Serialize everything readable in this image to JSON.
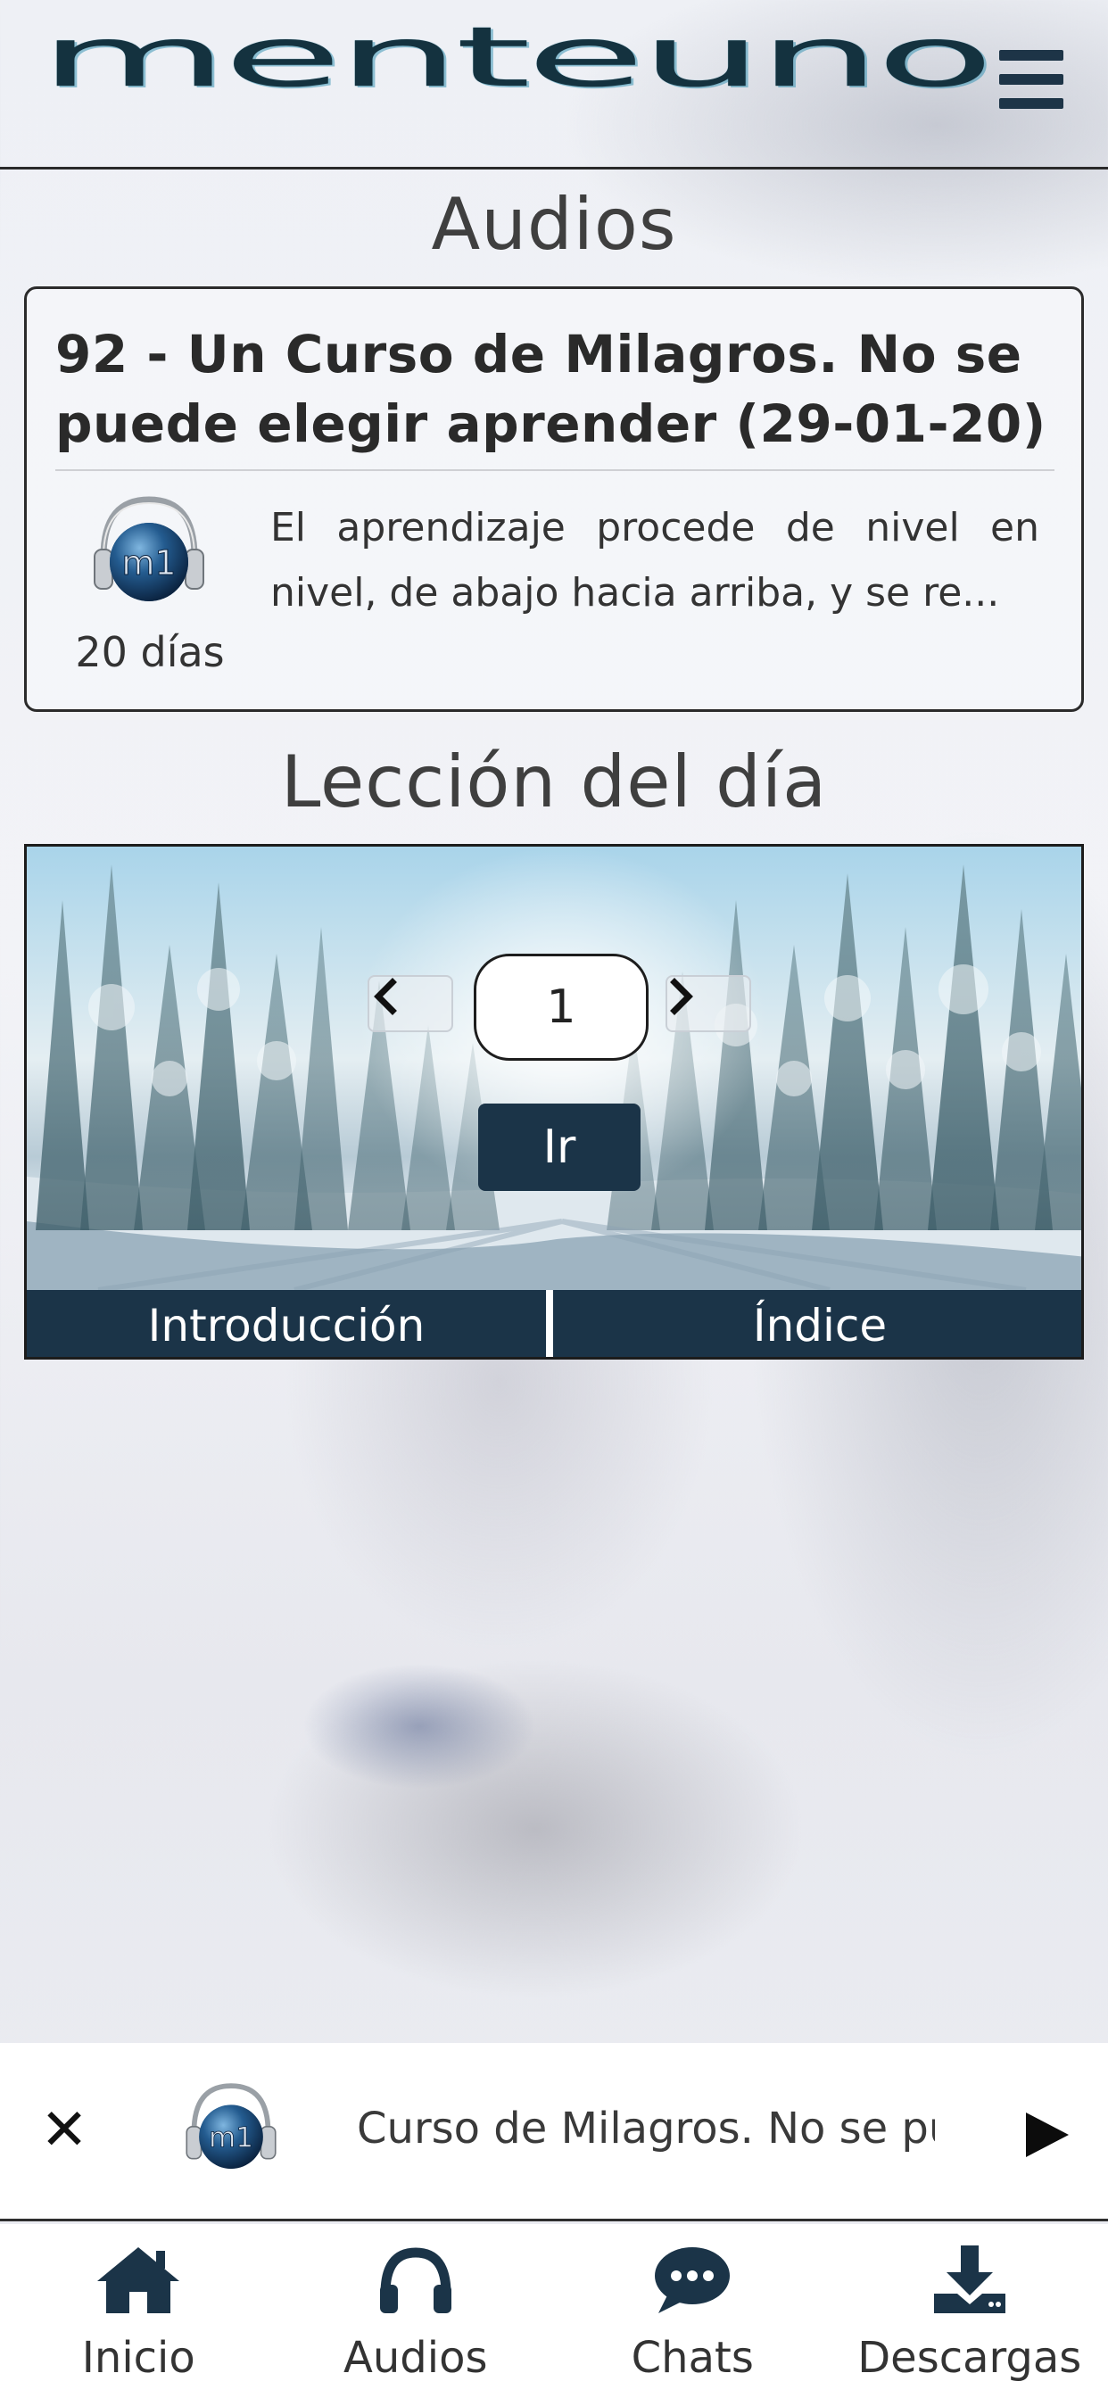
{
  "header": {
    "logo_text": "menteuno",
    "menu_icon": "hamburger-menu-icon",
    "brand_color": "#1b3448"
  },
  "audios_section": {
    "title": "Audios",
    "card": {
      "title": "92 - Un Curso de Milagros. No se puede elegir aprender (29-01-20)",
      "description": "El aprendizaje procede de nivel en nivel, de abajo hacia arriba, y se re...",
      "age": "20 días",
      "avatar_text": "m1"
    }
  },
  "lesson_section": {
    "title": "Lección del día",
    "lesson_number": "1",
    "go_label": "Ir",
    "tabs": [
      {
        "label": "Introducción"
      },
      {
        "label": "Índice"
      }
    ]
  },
  "player": {
    "now_playing": "Curso de Milagros. No se puede elegir aprender",
    "avatar_text": "m1"
  },
  "bottom_nav": {
    "items": [
      {
        "label": "Inicio",
        "icon": "home-icon"
      },
      {
        "label": "Audios",
        "icon": "headphones-icon"
      },
      {
        "label": "Chats",
        "icon": "chat-bubble-icon"
      },
      {
        "label": "Descargas",
        "icon": "download-icon"
      }
    ]
  }
}
